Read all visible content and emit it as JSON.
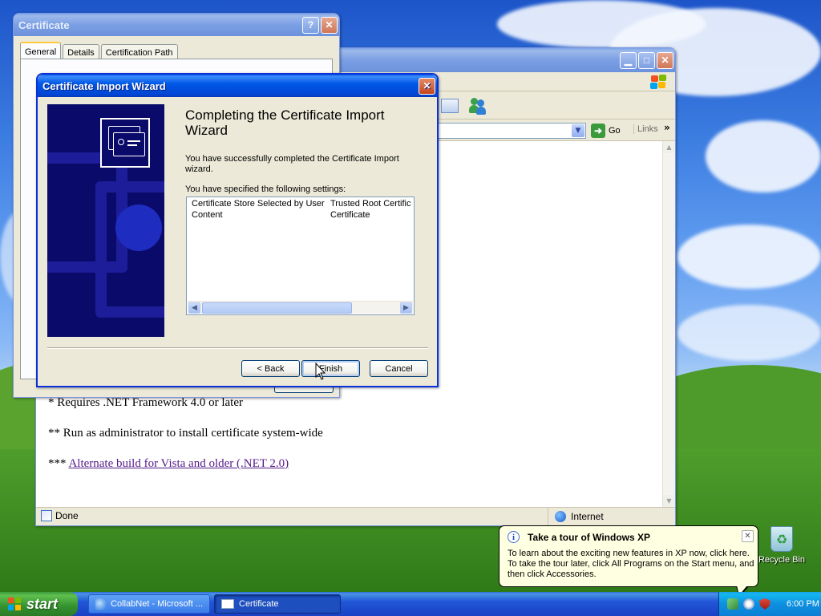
{
  "certificate_window": {
    "title": "Certificate",
    "tabs": [
      {
        "label": "General",
        "active": true
      },
      {
        "label": "Details",
        "active": false
      },
      {
        "label": "Certification Path",
        "active": false
      }
    ]
  },
  "browser": {
    "window_title": "",
    "address_go": "Go",
    "links_label": "Links",
    "content_lines": [
      "* Requires .NET Framework 4.0 or later",
      "** Run as administrator to install certificate system-wide"
    ],
    "content_prefix": "*** ",
    "content_link": "Alternate build for Vista and older (.NET 2.0)",
    "status_text": "Done",
    "zone_text": "Internet"
  },
  "wizard": {
    "title": "Certificate Import Wizard",
    "heading": "Completing the Certificate Import Wizard",
    "success_text": "You have successfully completed the Certificate Import wizard.",
    "settings_intro": "You have specified the following settings:",
    "settings": [
      {
        "name": "Certificate Store Selected by User",
        "value": "Trusted Root Certific"
      },
      {
        "name": "Content",
        "value": "Certificate"
      }
    ],
    "buttons": {
      "back": "< Back",
      "finish": "Finish",
      "cancel": "Cancel"
    }
  },
  "balloon": {
    "title": "Take a tour of Windows XP",
    "body": "To learn about the exciting new features in XP now, click here. To take the tour later, click All Programs on the Start menu, and then click Accessories."
  },
  "desktop": {
    "recycle_bin_label": "Recycle Bin"
  },
  "taskbar": {
    "start_label": "start",
    "tasks": [
      {
        "label": "CollabNet - Microsoft ...",
        "pressed": false
      },
      {
        "label": "Certificate",
        "pressed": true
      }
    ],
    "clock": "6:00 PM"
  },
  "colors": {
    "title_active": "#0058e6",
    "start_green": "#3c9b3c",
    "taskbar_blue": "#2157d7",
    "tray_blue": "#0e8fe0",
    "balloon_bg": "#ffffe1",
    "link_visited": "#551a8b"
  },
  "icons": [
    "help-icon",
    "close-icon",
    "minimize-icon",
    "maximize-icon",
    "windows-flag-icon",
    "edit-icon",
    "messenger-icon",
    "dropdown-icon",
    "go-arrow-icon",
    "chevron-right-icon",
    "ie-page-icon",
    "globe-icon",
    "certificate-icon",
    "info-icon",
    "recycle-bin-icon",
    "windows-logo-icon",
    "network-icon",
    "security-shield-icon",
    "mouse-cursor-icon"
  ]
}
